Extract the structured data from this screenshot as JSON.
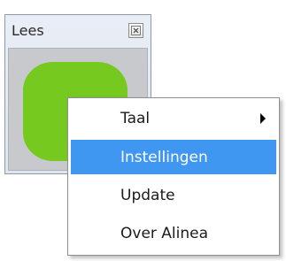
{
  "widget": {
    "title": "Lees",
    "close_icon": "close-box-icon",
    "logo_color": "#76c91e"
  },
  "context_menu": {
    "items": [
      {
        "label": "Taal",
        "has_submenu": true,
        "selected": false
      },
      {
        "label": "Instellingen",
        "has_submenu": false,
        "selected": true
      },
      {
        "label": "Update",
        "has_submenu": false,
        "selected": false
      },
      {
        "label": "Over Alinea",
        "has_submenu": false,
        "selected": false
      }
    ],
    "highlight_color": "#3f97f1"
  }
}
